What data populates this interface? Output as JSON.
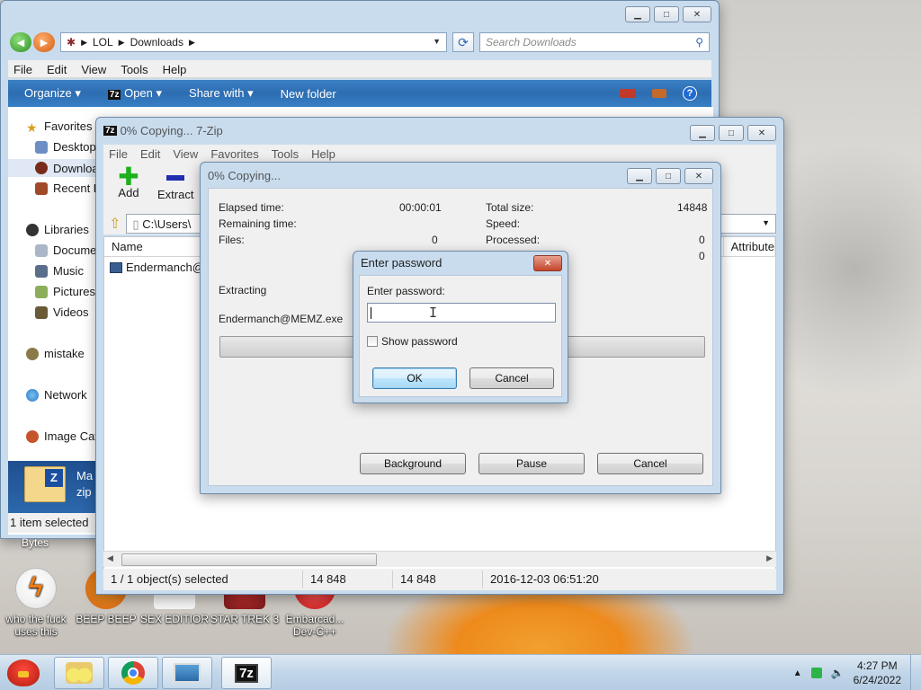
{
  "explorer": {
    "breadcrumb": [
      "LOL",
      "Downloads"
    ],
    "search_placeholder": "Search Downloads",
    "menu": [
      "File",
      "Edit",
      "View",
      "Tools",
      "Help"
    ],
    "commands": {
      "organize": "Organize",
      "open": "Open",
      "share": "Share with",
      "new_folder": "New folder"
    },
    "nav": {
      "favorites": "Favorites",
      "desktop": "Desktop",
      "downloads": "Downloa",
      "recent": "Recent P",
      "libraries": "Libraries",
      "documents": "Docume",
      "music": "Music",
      "pictures": "Pictures",
      "videos": "Videos",
      "mistake": "mistake",
      "network": "Network",
      "image_cat": "Image Cat"
    },
    "details": {
      "name": "Ma",
      "type": "zip"
    },
    "status": "1 item selected",
    "bytes": "Bytes"
  },
  "zip_fm": {
    "title": "0% Copying... 7-Zip",
    "menu": [
      "File",
      "Edit",
      "View",
      "Favorites",
      "Tools",
      "Help"
    ],
    "tools": {
      "add": "Add",
      "extract": "Extract",
      "test": "T"
    },
    "path": "C:\\Users\\",
    "columns": {
      "name": "Name",
      "attributes": "Attribute"
    },
    "row": "Endermanch@",
    "status": {
      "selected": "1 / 1 object(s) selected",
      "size": "14 848",
      "packed": "14 848",
      "modified": "2016-12-03 06:51:20"
    }
  },
  "progress": {
    "title": "0% Copying...",
    "elapsed_label": "Elapsed time:",
    "elapsed": "00:00:01",
    "remaining_label": "Remaining time:",
    "files_label": "Files:",
    "files": "0",
    "total_label": "Total size:",
    "total": "14848",
    "speed_label": "Speed:",
    "processed_label": "Processed:",
    "processed": "0",
    "extra": "0",
    "action": "Extracting",
    "file": "Endermanch@MEMZ.exe",
    "buttons": {
      "background": "Background",
      "pause": "Pause",
      "cancel": "Cancel"
    }
  },
  "password": {
    "title": "Enter password",
    "label": "Enter password:",
    "value": "",
    "show_password": "Show password",
    "ok": "OK",
    "cancel": "Cancel"
  },
  "desktop_icons": [
    {
      "label": "who the fuck uses this"
    },
    {
      "label": "BEEP BEEP"
    },
    {
      "label": "SEX EDITIOR"
    },
    {
      "label": "STAR TREK 3"
    },
    {
      "label": "Embarcad... Dev-C++"
    }
  ],
  "clock": {
    "time": "4:27 PM",
    "date": "6/24/2022"
  },
  "colors": {
    "accent": "#2d6db1",
    "desktop": "#d8d5d0",
    "taskbar": "#c2d6e8"
  }
}
